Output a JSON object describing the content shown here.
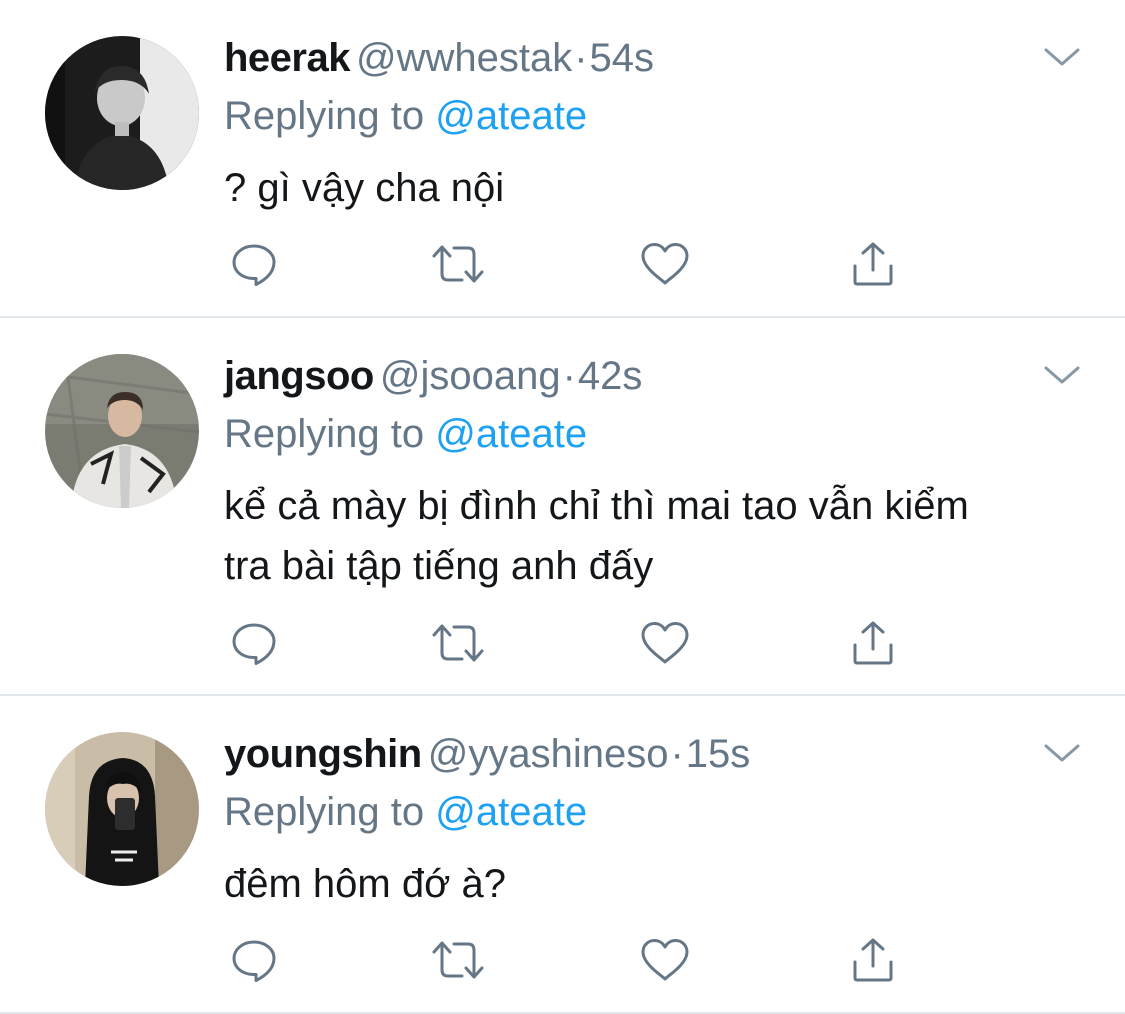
{
  "colors": {
    "name": "#14171a",
    "secondary": "#657786",
    "mention": "#1da1f2",
    "divider": "#e1e6ea",
    "icon": "#657786"
  },
  "action_icons": [
    "reply-icon",
    "retweet-icon",
    "like-icon",
    "share-icon"
  ],
  "tweets": [
    {
      "display_name": "heerak",
      "handle": "@wwhestak",
      "separator": "·",
      "time": "54s",
      "replying_prefix": "Replying to",
      "replying_to": "@ateate",
      "text_lines": [
        "? gì vậy cha nội"
      ]
    },
    {
      "display_name": "jangsoo",
      "handle": "@jsooang",
      "separator": "·",
      "time": "42s",
      "replying_prefix": "Replying to",
      "replying_to": "@ateate",
      "text_lines": [
        "kể cả mày bị đình chỉ thì mai tao vẫn kiểm",
        "tra bài tập tiếng anh đấy"
      ]
    },
    {
      "display_name": "youngshin",
      "handle": "@yyashineso",
      "separator": "·",
      "time": "15s",
      "replying_prefix": "Replying to",
      "replying_to": "@ateate",
      "text_lines": [
        "đêm hôm đớ à?"
      ]
    }
  ]
}
